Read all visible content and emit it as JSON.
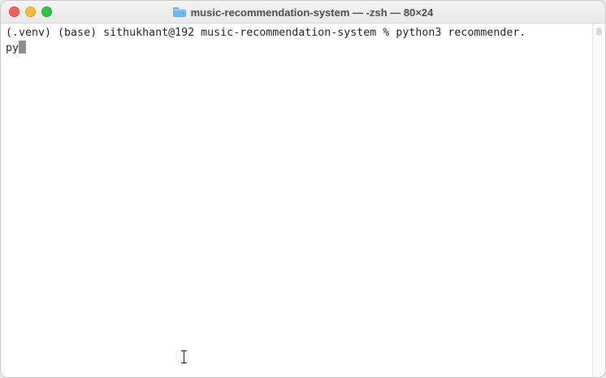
{
  "window": {
    "title": "music-recommendation-system — -zsh — 80×24",
    "title_icon": "folder-icon",
    "controls": [
      "close",
      "minimize",
      "zoom"
    ]
  },
  "terminal": {
    "line1": "(.venv) (base) sithukhant@192 music-recommendation-system % python3 recommender.",
    "line2": "py"
  },
  "colors": {
    "close": "#fe5f57",
    "minimize": "#febc2e",
    "zoom": "#28c840",
    "background": "#ffffff",
    "text": "#222222"
  }
}
